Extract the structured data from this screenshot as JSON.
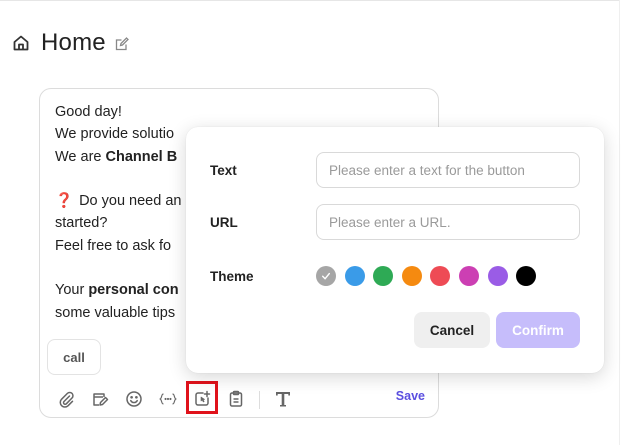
{
  "header": {
    "title": "Home",
    "home_icon": "home-icon",
    "edit_icon": "edit-icon"
  },
  "message": {
    "lines": [
      {
        "text": "Good day!"
      },
      {
        "text": "We provide solutio"
      },
      {
        "prefix": "We are ",
        "bold": "Channel B"
      },
      {
        "text": ""
      },
      {
        "emoji": "❓",
        "text": "Do you need an"
      },
      {
        "text": "started?"
      },
      {
        "text": "Feel free to ask fo"
      },
      {
        "text": ""
      },
      {
        "prefix": "Your ",
        "bold": "personal con"
      },
      {
        "text": "some valuable tips"
      }
    ]
  },
  "chip": {
    "label": "call"
  },
  "toolbar": {
    "save_label": "Save",
    "icons": [
      "paperclip-icon",
      "card-edit-icon",
      "smiley-icon",
      "variable-braces-icon",
      "add-button-icon",
      "clipboard-icon",
      "text-format-icon"
    ],
    "highlighted": "add-button-icon"
  },
  "popup": {
    "text_label": "Text",
    "text_placeholder": "Please enter a text for the button",
    "url_label": "URL",
    "url_placeholder": "Please enter a URL.",
    "theme_label": "Theme",
    "themes": [
      {
        "name": "gray",
        "color": "#a6a6a6",
        "selected": true
      },
      {
        "name": "blue",
        "color": "#3a9be8"
      },
      {
        "name": "green",
        "color": "#2eaa55"
      },
      {
        "name": "orange",
        "color": "#f58a10"
      },
      {
        "name": "red",
        "color": "#ee4b55"
      },
      {
        "name": "magenta",
        "color": "#cc3fb3"
      },
      {
        "name": "purple",
        "color": "#9a5ce6"
      },
      {
        "name": "black",
        "color": "#000000"
      }
    ],
    "cancel_label": "Cancel",
    "confirm_label": "Confirm"
  },
  "colors": {
    "accent": "#5b4fe0",
    "confirm_disabled": "#c6bdfb",
    "highlight": "#e0121b"
  }
}
